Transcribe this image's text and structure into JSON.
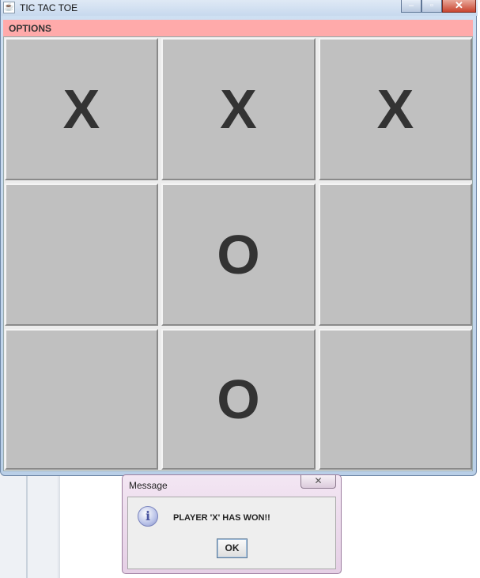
{
  "window": {
    "title": "TIC TAC TOE",
    "icon": "java-cup-icon",
    "controls": {
      "minimize": "–",
      "maximize": "▫",
      "close": "✕"
    }
  },
  "menubar": {
    "options_label": "OPTIONS"
  },
  "board": {
    "cells": [
      "X",
      "X",
      "X",
      "",
      "O",
      "",
      "",
      "O",
      ""
    ]
  },
  "dialog": {
    "title": "Message",
    "close_label": "✕",
    "icon": "info-icon",
    "icon_glyph": "i",
    "message": "PLAYER  'X'  HAS WON!!",
    "ok_label": "OK"
  },
  "colors": {
    "menubar_bg": "#ffaaaa",
    "cell_bg": "#c0c0c0",
    "mark": "#333333"
  }
}
